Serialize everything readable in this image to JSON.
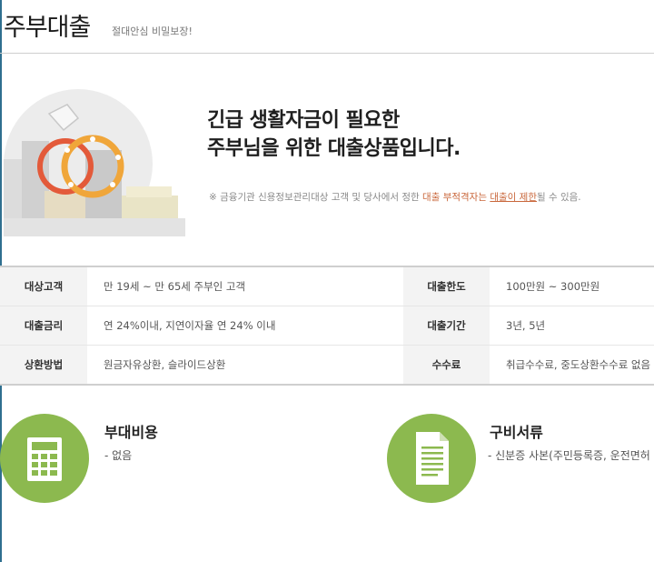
{
  "header": {
    "title": "주부대출",
    "subtitle": "절대안심 비밀보장!"
  },
  "hero": {
    "headline_line1": "긴급 생활자금이 필요한",
    "headline_line2": "주부님을 위한 대출상품입니다.",
    "notice_prefix": "※ 금융기관 신용정보관리대상 고객 및 당사에서 정한 ",
    "notice_highlight1": "대출 부적격자는",
    "notice_space": " ",
    "notice_highlight2": "대출이 제한",
    "notice_suffix": "될 수 있음."
  },
  "info": {
    "rows": [
      {
        "label1": "대상고객",
        "value1": "만 19세 ~ 만 65세 주부인 고객",
        "label2": "대출한도",
        "value2": "100만원 ~ 300만원"
      },
      {
        "label1": "대출금리",
        "value1": "연 24%이내, 지연이자율 연 24% 이내",
        "label2": "대출기간",
        "value2": "3년, 5년"
      },
      {
        "label1": "상환방법",
        "value1": "원금자유상환, 슬라이드상환",
        "label2": "수수료",
        "value2": "취급수수료, 중도상환수수료 없음"
      }
    ]
  },
  "features": {
    "cost_title": "부대비용",
    "cost_desc": "- 없음",
    "docs_title": "구비서류",
    "docs_desc": "- 신분증 사본(주민등록증, 운전면허"
  },
  "colors": {
    "accent_green": "#8cb94f",
    "warning_orange": "#c9673b",
    "label_bg": "#f3f3f3"
  },
  "icons": {
    "hero": "wedding-rings-illustration",
    "cost": "calculator-icon",
    "docs": "document-icon"
  }
}
